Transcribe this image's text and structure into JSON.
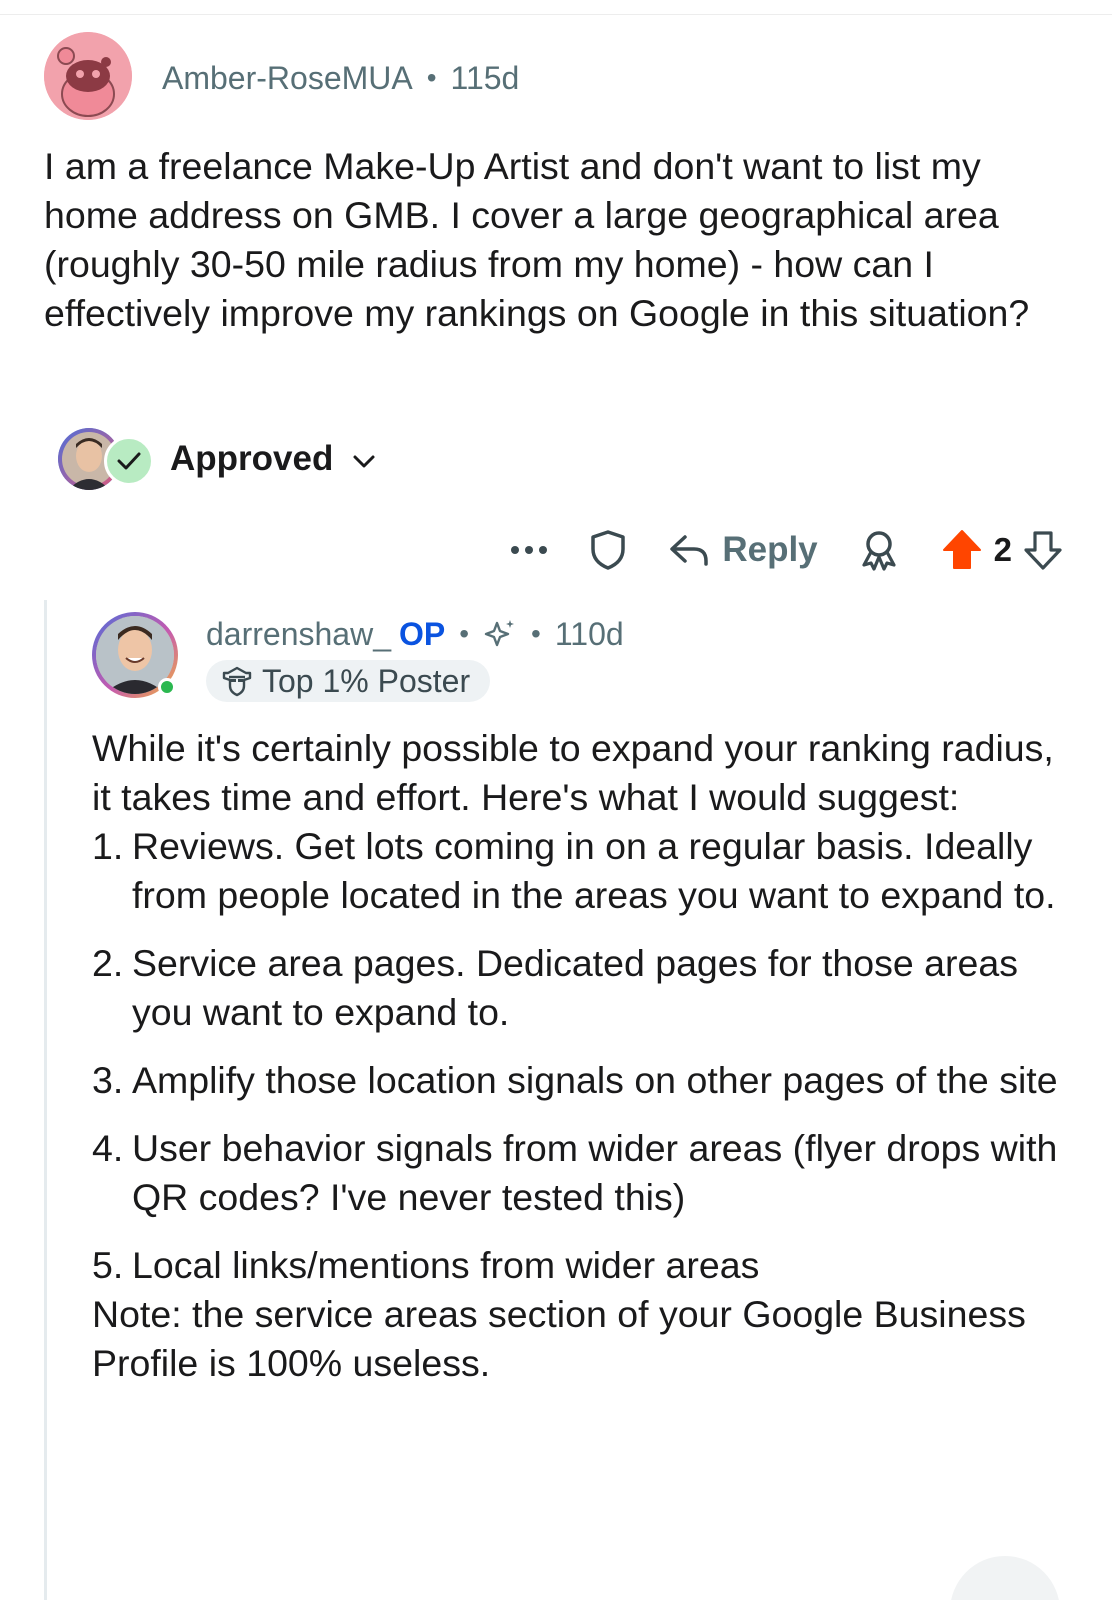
{
  "parent_comment": {
    "author": "Amber-RoseMUA",
    "separator": "•",
    "age": "115d",
    "body": "I am a freelance Make-Up Artist and don't want to list my home address on GMB. I cover a large geographical area (roughly 30-50 mile radius from my home) - how can I effectively improve my rankings on Google in this situation?",
    "avatar_icon": "snoo-avatar-icon"
  },
  "moderation": {
    "status_label": "Approved",
    "badge_icon": "check-icon",
    "dropdown_icon": "chevron-down-icon"
  },
  "action_bar": {
    "more_icon": "more-horizontal-icon",
    "save_icon": "shield-icon",
    "reply_label": "Reply",
    "award_icon": "award-icon",
    "score": "2",
    "upvote_color": "#ff4500"
  },
  "reply_comment": {
    "author": "darrenshaw_",
    "op_label": "OP",
    "separator": "•",
    "age": "110d",
    "flair_label": "Top 1% Poster",
    "intro": "While it's certainly possible to expand your ranking radius, it takes time and effort. Here's what I would suggest:",
    "list": [
      {
        "num": "1.",
        "text": "Reviews. Get lots coming in on a regular basis. Ideally from people located in the areas you want to expand to."
      },
      {
        "num": "2.",
        "text": "Service area pages. Dedicated pages for those areas you want to expand to."
      },
      {
        "num": "3.",
        "text": "Amplify those location signals on other pages of the site"
      },
      {
        "num": "4.",
        "text": "User behavior signals from wider areas (flyer drops with QR codes? I've never tested this)"
      },
      {
        "num": "5.",
        "text": "Local links/mentions from wider areas"
      }
    ],
    "note": "Note: the service areas section of your Google Business Profile is 100% useless.",
    "op_color": "#0a53e0",
    "online_color": "#2bb850"
  }
}
